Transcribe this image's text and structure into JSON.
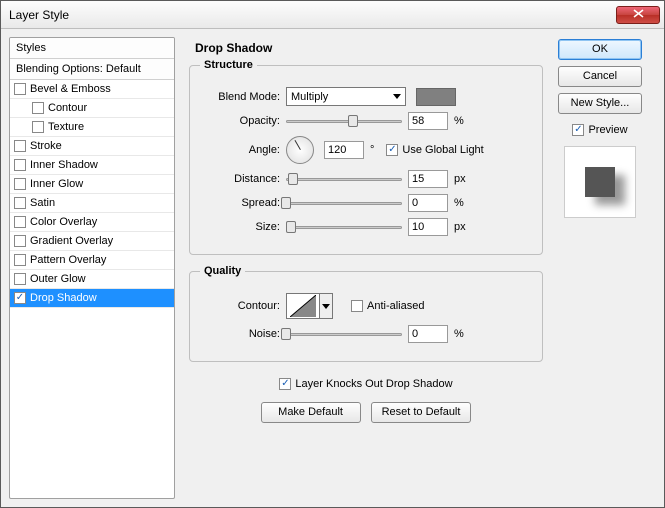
{
  "window": {
    "title": "Layer Style"
  },
  "sidebar": {
    "styles_header": "Styles",
    "blending_header": "Blending Options: Default",
    "items": [
      {
        "label": "Bevel & Emboss",
        "checked": false,
        "indent": 0
      },
      {
        "label": "Contour",
        "checked": false,
        "indent": 1
      },
      {
        "label": "Texture",
        "checked": false,
        "indent": 1
      },
      {
        "label": "Stroke",
        "checked": false,
        "indent": 0
      },
      {
        "label": "Inner Shadow",
        "checked": false,
        "indent": 0
      },
      {
        "label": "Inner Glow",
        "checked": false,
        "indent": 0
      },
      {
        "label": "Satin",
        "checked": false,
        "indent": 0
      },
      {
        "label": "Color Overlay",
        "checked": false,
        "indent": 0
      },
      {
        "label": "Gradient Overlay",
        "checked": false,
        "indent": 0
      },
      {
        "label": "Pattern Overlay",
        "checked": false,
        "indent": 0
      },
      {
        "label": "Outer Glow",
        "checked": false,
        "indent": 0
      },
      {
        "label": "Drop Shadow",
        "checked": true,
        "indent": 0,
        "selected": true
      }
    ]
  },
  "panel": {
    "title": "Drop Shadow",
    "structure_legend": "Structure",
    "quality_legend": "Quality",
    "blend_mode_label": "Blend Mode:",
    "blend_mode_value": "Multiply",
    "color_swatch": "#808080",
    "opacity_label": "Opacity:",
    "opacity_value": "58",
    "opacity_unit": "%",
    "opacity_pct": 58,
    "angle_label": "Angle:",
    "angle_value": "120",
    "angle_unit": "°",
    "global_light_label": "Use Global Light",
    "global_light_checked": true,
    "distance_label": "Distance:",
    "distance_value": "15",
    "distance_unit": "px",
    "distance_pct": 6,
    "spread_label": "Spread:",
    "spread_value": "0",
    "spread_unit": "%",
    "spread_pct": 0,
    "size_label": "Size:",
    "size_value": "10",
    "size_unit": "px",
    "size_pct": 4,
    "contour_label": "Contour:",
    "anti_aliased_label": "Anti-aliased",
    "anti_aliased_checked": false,
    "noise_label": "Noise:",
    "noise_value": "0",
    "noise_unit": "%",
    "noise_pct": 0,
    "knockout_label": "Layer Knocks Out Drop Shadow",
    "knockout_checked": true,
    "make_default_label": "Make Default",
    "reset_default_label": "Reset to Default"
  },
  "right": {
    "ok": "OK",
    "cancel": "Cancel",
    "new_style": "New Style...",
    "preview_label": "Preview",
    "preview_checked": true
  }
}
